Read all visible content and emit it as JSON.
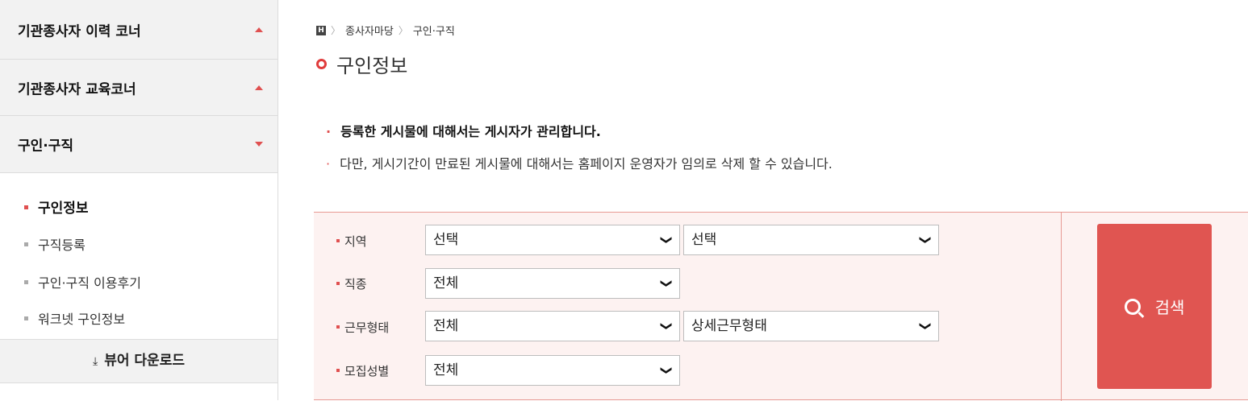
{
  "sidebar": {
    "accordions": [
      {
        "label": "기관종사자 이력 코너",
        "state": "collapsed"
      },
      {
        "label": "기관종사자 교육코너",
        "state": "collapsed"
      },
      {
        "label": "구인·구직",
        "state": "expanded"
      }
    ],
    "sub_items": [
      {
        "label": "구인정보",
        "active": true
      },
      {
        "label": "구직등록",
        "active": false
      },
      {
        "label": "구인·구직 이용후기",
        "active": false
      },
      {
        "label": "워크넷 구인정보",
        "active": false
      }
    ],
    "download": {
      "icon": "download-icon",
      "glyph": "⤓",
      "label": "뷰어 다운로드"
    }
  },
  "breadcrumb": {
    "home_icon": "home-icon",
    "home_glyph": "H",
    "items": [
      "종사자마당",
      "구인·구직"
    ],
    "separator": "〉"
  },
  "page_title": "구인정보",
  "notices": [
    "등록한 게시물에 대해서는 게시자가 관리합니다.",
    "다만, 게시기간이 만료된 게시물에 대해서는 홈페이지 운영자가 임의로 삭제 할 수 있습니다."
  ],
  "search": {
    "region": {
      "label": "지역",
      "select1": "선택",
      "select2": "선택"
    },
    "job_type": {
      "label": "직종",
      "select1": "전체"
    },
    "work_type": {
      "label": "근무형태",
      "select1": "전체",
      "select2": "상세근무형태"
    },
    "gender": {
      "label": "모집성별",
      "select1": "전체"
    },
    "button_label": "검색",
    "button_icon": "search-icon"
  },
  "colors": {
    "accent": "#e05551",
    "panel_bg": "#fdf2f1",
    "panel_border": "#e79a94",
    "sidebar_bg": "#f2f2f2"
  }
}
